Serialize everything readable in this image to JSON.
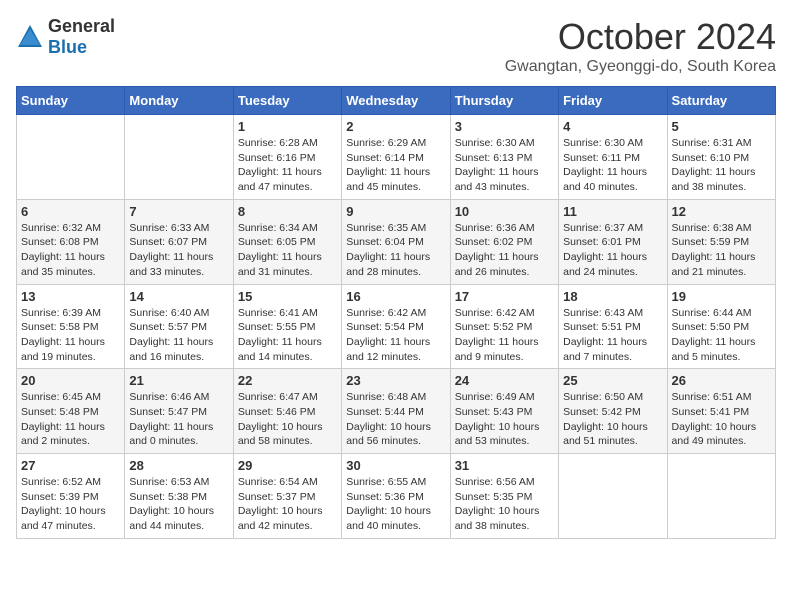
{
  "logo": {
    "general": "General",
    "blue": "Blue"
  },
  "title": "October 2024",
  "location": "Gwangtan, Gyeonggi-do, South Korea",
  "days_of_week": [
    "Sunday",
    "Monday",
    "Tuesday",
    "Wednesday",
    "Thursday",
    "Friday",
    "Saturday"
  ],
  "weeks": [
    [
      null,
      null,
      {
        "day": "1",
        "sunrise": "Sunrise: 6:28 AM",
        "sunset": "Sunset: 6:16 PM",
        "daylight": "Daylight: 11 hours and 47 minutes."
      },
      {
        "day": "2",
        "sunrise": "Sunrise: 6:29 AM",
        "sunset": "Sunset: 6:14 PM",
        "daylight": "Daylight: 11 hours and 45 minutes."
      },
      {
        "day": "3",
        "sunrise": "Sunrise: 6:30 AM",
        "sunset": "Sunset: 6:13 PM",
        "daylight": "Daylight: 11 hours and 43 minutes."
      },
      {
        "day": "4",
        "sunrise": "Sunrise: 6:30 AM",
        "sunset": "Sunset: 6:11 PM",
        "daylight": "Daylight: 11 hours and 40 minutes."
      },
      {
        "day": "5",
        "sunrise": "Sunrise: 6:31 AM",
        "sunset": "Sunset: 6:10 PM",
        "daylight": "Daylight: 11 hours and 38 minutes."
      }
    ],
    [
      {
        "day": "6",
        "sunrise": "Sunrise: 6:32 AM",
        "sunset": "Sunset: 6:08 PM",
        "daylight": "Daylight: 11 hours and 35 minutes."
      },
      {
        "day": "7",
        "sunrise": "Sunrise: 6:33 AM",
        "sunset": "Sunset: 6:07 PM",
        "daylight": "Daylight: 11 hours and 33 minutes."
      },
      {
        "day": "8",
        "sunrise": "Sunrise: 6:34 AM",
        "sunset": "Sunset: 6:05 PM",
        "daylight": "Daylight: 11 hours and 31 minutes."
      },
      {
        "day": "9",
        "sunrise": "Sunrise: 6:35 AM",
        "sunset": "Sunset: 6:04 PM",
        "daylight": "Daylight: 11 hours and 28 minutes."
      },
      {
        "day": "10",
        "sunrise": "Sunrise: 6:36 AM",
        "sunset": "Sunset: 6:02 PM",
        "daylight": "Daylight: 11 hours and 26 minutes."
      },
      {
        "day": "11",
        "sunrise": "Sunrise: 6:37 AM",
        "sunset": "Sunset: 6:01 PM",
        "daylight": "Daylight: 11 hours and 24 minutes."
      },
      {
        "day": "12",
        "sunrise": "Sunrise: 6:38 AM",
        "sunset": "Sunset: 5:59 PM",
        "daylight": "Daylight: 11 hours and 21 minutes."
      }
    ],
    [
      {
        "day": "13",
        "sunrise": "Sunrise: 6:39 AM",
        "sunset": "Sunset: 5:58 PM",
        "daylight": "Daylight: 11 hours and 19 minutes."
      },
      {
        "day": "14",
        "sunrise": "Sunrise: 6:40 AM",
        "sunset": "Sunset: 5:57 PM",
        "daylight": "Daylight: 11 hours and 16 minutes."
      },
      {
        "day": "15",
        "sunrise": "Sunrise: 6:41 AM",
        "sunset": "Sunset: 5:55 PM",
        "daylight": "Daylight: 11 hours and 14 minutes."
      },
      {
        "day": "16",
        "sunrise": "Sunrise: 6:42 AM",
        "sunset": "Sunset: 5:54 PM",
        "daylight": "Daylight: 11 hours and 12 minutes."
      },
      {
        "day": "17",
        "sunrise": "Sunrise: 6:42 AM",
        "sunset": "Sunset: 5:52 PM",
        "daylight": "Daylight: 11 hours and 9 minutes."
      },
      {
        "day": "18",
        "sunrise": "Sunrise: 6:43 AM",
        "sunset": "Sunset: 5:51 PM",
        "daylight": "Daylight: 11 hours and 7 minutes."
      },
      {
        "day": "19",
        "sunrise": "Sunrise: 6:44 AM",
        "sunset": "Sunset: 5:50 PM",
        "daylight": "Daylight: 11 hours and 5 minutes."
      }
    ],
    [
      {
        "day": "20",
        "sunrise": "Sunrise: 6:45 AM",
        "sunset": "Sunset: 5:48 PM",
        "daylight": "Daylight: 11 hours and 2 minutes."
      },
      {
        "day": "21",
        "sunrise": "Sunrise: 6:46 AM",
        "sunset": "Sunset: 5:47 PM",
        "daylight": "Daylight: 11 hours and 0 minutes."
      },
      {
        "day": "22",
        "sunrise": "Sunrise: 6:47 AM",
        "sunset": "Sunset: 5:46 PM",
        "daylight": "Daylight: 10 hours and 58 minutes."
      },
      {
        "day": "23",
        "sunrise": "Sunrise: 6:48 AM",
        "sunset": "Sunset: 5:44 PM",
        "daylight": "Daylight: 10 hours and 56 minutes."
      },
      {
        "day": "24",
        "sunrise": "Sunrise: 6:49 AM",
        "sunset": "Sunset: 5:43 PM",
        "daylight": "Daylight: 10 hours and 53 minutes."
      },
      {
        "day": "25",
        "sunrise": "Sunrise: 6:50 AM",
        "sunset": "Sunset: 5:42 PM",
        "daylight": "Daylight: 10 hours and 51 minutes."
      },
      {
        "day": "26",
        "sunrise": "Sunrise: 6:51 AM",
        "sunset": "Sunset: 5:41 PM",
        "daylight": "Daylight: 10 hours and 49 minutes."
      }
    ],
    [
      {
        "day": "27",
        "sunrise": "Sunrise: 6:52 AM",
        "sunset": "Sunset: 5:39 PM",
        "daylight": "Daylight: 10 hours and 47 minutes."
      },
      {
        "day": "28",
        "sunrise": "Sunrise: 6:53 AM",
        "sunset": "Sunset: 5:38 PM",
        "daylight": "Daylight: 10 hours and 44 minutes."
      },
      {
        "day": "29",
        "sunrise": "Sunrise: 6:54 AM",
        "sunset": "Sunset: 5:37 PM",
        "daylight": "Daylight: 10 hours and 42 minutes."
      },
      {
        "day": "30",
        "sunrise": "Sunrise: 6:55 AM",
        "sunset": "Sunset: 5:36 PM",
        "daylight": "Daylight: 10 hours and 40 minutes."
      },
      {
        "day": "31",
        "sunrise": "Sunrise: 6:56 AM",
        "sunset": "Sunset: 5:35 PM",
        "daylight": "Daylight: 10 hours and 38 minutes."
      },
      null,
      null
    ]
  ]
}
